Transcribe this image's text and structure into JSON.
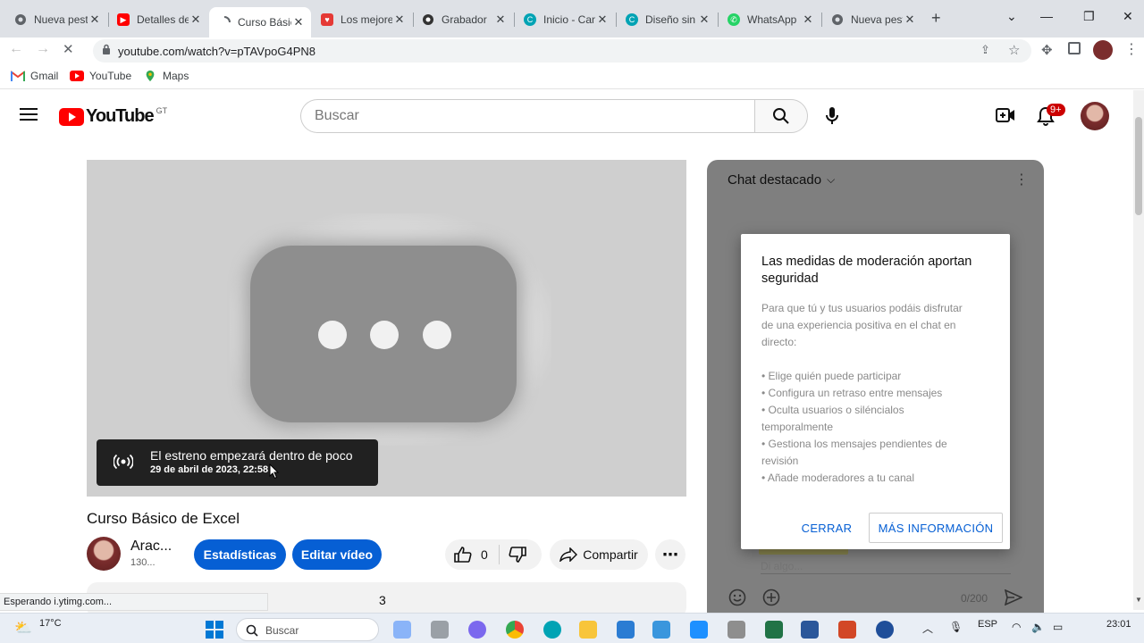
{
  "browser": {
    "tabs": [
      {
        "title": "Nueva pestaña",
        "icon": "chrome-icon",
        "color": "#5f6368"
      },
      {
        "title": "Detalles del vídeo",
        "icon": "youtube-studio-icon",
        "color": "#ff0000"
      },
      {
        "title": "Curso Básico de Excel",
        "icon": "loading-icon",
        "color": "#5f6368"
      },
      {
        "title": "Los mejores",
        "icon": "red-heart-icon",
        "color": "#e53935"
      },
      {
        "title": "Grabador",
        "icon": "recorder-icon",
        "color": "#333333"
      },
      {
        "title": "Inicio - Canva",
        "icon": "canva-icon",
        "color": "#00a3b4"
      },
      {
        "title": "Diseño sin título",
        "icon": "canva-icon",
        "color": "#00a3b4"
      },
      {
        "title": "WhatsApp",
        "icon": "whatsapp-icon",
        "color": "#25d366"
      },
      {
        "title": "Nueva pestaña",
        "icon": "chrome-icon",
        "color": "#5f6368"
      }
    ],
    "new_tab_label": "+",
    "url": "youtube.com/watch?v=pTAVpoG4PN8",
    "bookmarks": [
      {
        "label": "Gmail",
        "icon": "gmail-icon"
      },
      {
        "label": "YouTube",
        "icon": "youtube-icon"
      },
      {
        "label": "Maps",
        "icon": "maps-icon"
      }
    ]
  },
  "youtube": {
    "logo_text": "YouTube",
    "country_code": "GT",
    "search_placeholder": "Buscar",
    "notifications_badge": "9+",
    "accent": "#ff0000",
    "player": {
      "premiere_title": "El estreno empezará dentro de poco",
      "premiere_date": "29 de abril de 2023, 22:58"
    },
    "video_title": "Curso Básico de Excel",
    "channel_name": "Arac...",
    "channel_subs": "130...",
    "stats_button": "Estadísticas",
    "edit_button": "Editar vídeo",
    "like_count": "0",
    "share_label": "Compartir",
    "description_fragment": "3"
  },
  "chat": {
    "header": "Chat destacado",
    "input_placeholder": "Di algo...",
    "char_count": "0/200",
    "dialog": {
      "title": "Las medidas de moderación aportan seguridad",
      "body_lines": [
        "Para que tú y tus usuarios podáis disfrutar",
        "de una experiencia positiva en el chat en",
        "directo:",
        "",
        "• Elige quién puede participar",
        "• Configura un retraso entre mensajes",
        "• Oculta usuarios o siléncialos",
        "temporalmente",
        "• Gestiona los mensajes pendientes de",
        "revisión",
        "• Añade moderadores a tu canal"
      ],
      "close_label": "CERRAR",
      "more_label": "MÁS INFORMACIÓN",
      "link_color": "#065fd4"
    }
  },
  "status_text": "Esperando i.ytimg.com...",
  "taskbar": {
    "weather": "17°C",
    "search_placeholder": "Buscar",
    "language": "ESP",
    "time": "23:01"
  }
}
